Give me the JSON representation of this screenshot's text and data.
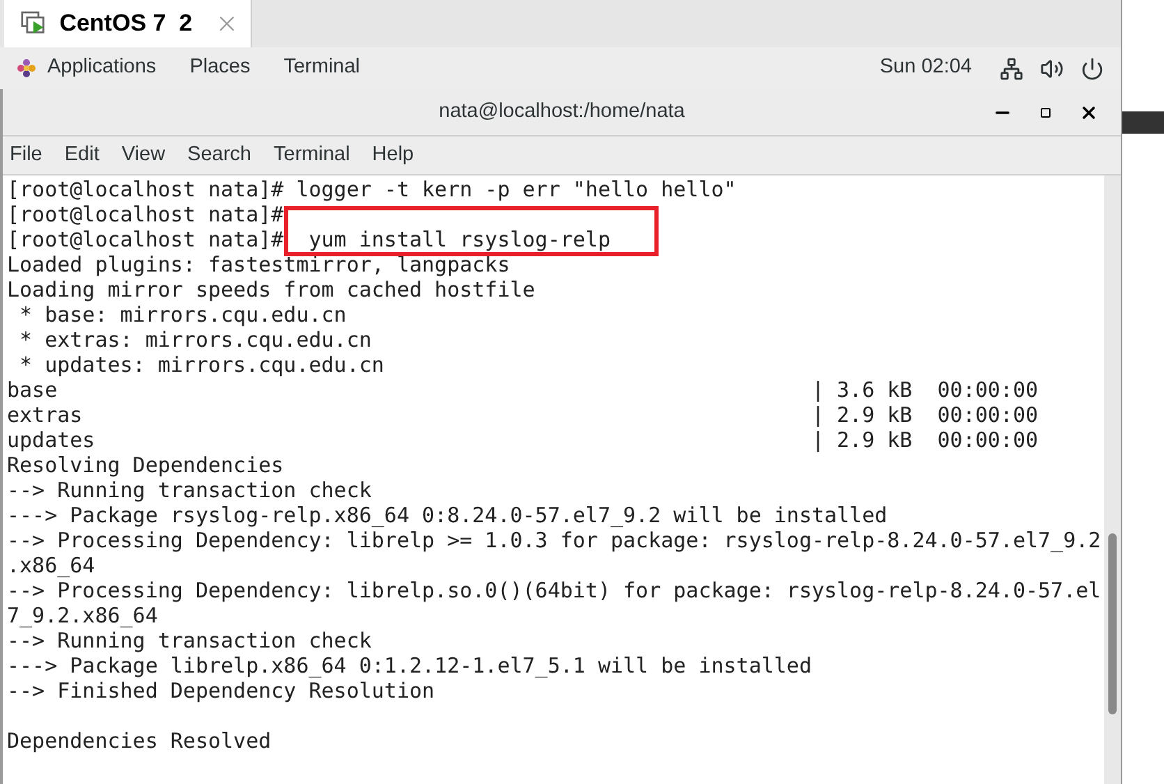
{
  "vm_tab": {
    "title": "CentOS 7  2"
  },
  "top_panel": {
    "menus": [
      "Applications",
      "Places",
      "Terminal"
    ],
    "clock": "Sun 02:04"
  },
  "terminal": {
    "title": "nata@localhost:/home/nata",
    "menu": [
      "File",
      "Edit",
      "View",
      "Search",
      "Terminal",
      "Help"
    ],
    "paragraphs": [
      [
        "[root@localhost nata]# logger -t kern -p err \"hello hello\"",
        "[root@localhost nata]#",
        "[root@localhost nata]#  yum install rsyslog-relp",
        "Loaded plugins: fastestmirror, langpacks",
        "Loading mirror speeds from cached hostfile",
        " * base: mirrors.cqu.edu.cn",
        " * extras: mirrors.cqu.edu.cn",
        " * updates: mirrors.cqu.edu.cn",
        "base                                                            | 3.6 kB  00:00:00",
        "extras                                                          | 2.9 kB  00:00:00",
        "updates                                                         | 2.9 kB  00:00:00",
        "Resolving Dependencies",
        "--> Running transaction check",
        "---> Package rsyslog-relp.x86_64 0:8.24.0-57.el7_9.2 will be installed",
        "--> Processing Dependency: librelp >= 1.0.3 for package: rsyslog-relp-8.24.0-57.el7_9.2",
        ".x86_64",
        "--> Processing Dependency: librelp.so.0()(64bit) for package: rsyslog-relp-8.24.0-57.el",
        "7_9.2.x86_64",
        "--> Running transaction check",
        "---> Package librelp.x86_64 0:1.2.12-1.el7_5.1 will be installed",
        "--> Finished Dependency Resolution"
      ],
      [
        "Dependencies Resolved"
      ]
    ]
  }
}
